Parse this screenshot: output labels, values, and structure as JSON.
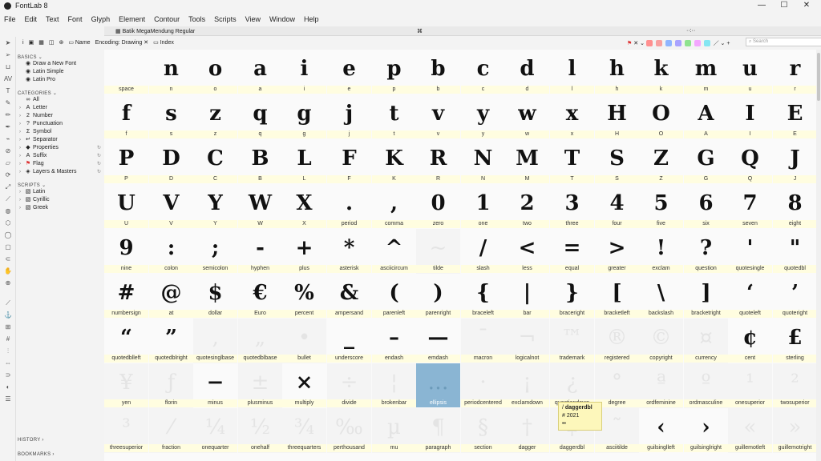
{
  "app": {
    "title": "FontLab 8"
  },
  "menu": [
    "File",
    "Edit",
    "Text",
    "Font",
    "Glyph",
    "Element",
    "Contour",
    "Tools",
    "Scripts",
    "View",
    "Window",
    "Help"
  ],
  "window_controls": {
    "minimize": "—",
    "maximize": "☐",
    "close": "✕"
  },
  "doc_tab": {
    "name": "Batik MegaMendung Regular",
    "center_mark": "⌘",
    "right_mark": "··:··"
  },
  "toolbar": {
    "info": "i",
    "name_label": "Name",
    "encoding_label": "Encoding: Drawing",
    "index_label": "Index",
    "search_placeholder": "Search",
    "color_swatches": [
      "#ff8f8f",
      "#f8a0a0",
      "#8fb5ff",
      "#a9a3ff",
      "#8fe38f",
      "#f4a6ff",
      "#86e6f2"
    ]
  },
  "sidebar": {
    "basics_header": "BASICS",
    "basics": [
      "Draw a New Font",
      "Latin Simple",
      "Latin Pro"
    ],
    "categories_header": "CATEGORIES",
    "categories": [
      {
        "label": "All",
        "icon": "∞"
      },
      {
        "label": "Letter",
        "icon": "A"
      },
      {
        "label": "Number",
        "icon": "2"
      },
      {
        "label": "Punctuation",
        "icon": "?"
      },
      {
        "label": "Symbol",
        "icon": "Σ"
      },
      {
        "label": "Separator",
        "icon": "↵"
      },
      {
        "label": "Properties",
        "icon": "◆"
      },
      {
        "label": "Suffix",
        "icon": "A"
      },
      {
        "label": "Flag",
        "icon": "⚑"
      },
      {
        "label": "Layers & Masters",
        "icon": "◈"
      }
    ],
    "scripts_header": "SCRIPTS",
    "scripts": [
      "Latin",
      "Cyrillic",
      "Greek"
    ],
    "history_header": "HISTORY",
    "bookmarks_header": "BOOKMARKS"
  },
  "glyph_rows": [
    [
      [
        "",
        "space"
      ],
      [
        "n",
        "n"
      ],
      [
        "o",
        "o"
      ],
      [
        "a",
        "a"
      ],
      [
        "i",
        "i"
      ],
      [
        "e",
        "e"
      ],
      [
        "p",
        "p"
      ],
      [
        "b",
        "b"
      ],
      [
        "c",
        "c"
      ],
      [
        "d",
        "d"
      ],
      [
        "l",
        "l"
      ],
      [
        "h",
        "h"
      ],
      [
        "k",
        "k"
      ],
      [
        "m",
        "m"
      ],
      [
        "u",
        "u"
      ],
      [
        "r",
        "r"
      ]
    ],
    [
      [
        "f",
        "f"
      ],
      [
        "s",
        "s"
      ],
      [
        "z",
        "z"
      ],
      [
        "q",
        "q"
      ],
      [
        "g",
        "g"
      ],
      [
        "j",
        "j"
      ],
      [
        "t",
        "t"
      ],
      [
        "v",
        "v"
      ],
      [
        "y",
        "y"
      ],
      [
        "w",
        "w"
      ],
      [
        "x",
        "x"
      ],
      [
        "H",
        "H"
      ],
      [
        "O",
        "O"
      ],
      [
        "A",
        "A"
      ],
      [
        "I",
        "I"
      ],
      [
        "E",
        "E"
      ]
    ],
    [
      [
        "P",
        "P"
      ],
      [
        "D",
        "D"
      ],
      [
        "C",
        "C"
      ],
      [
        "B",
        "B"
      ],
      [
        "L",
        "L"
      ],
      [
        "F",
        "F"
      ],
      [
        "K",
        "K"
      ],
      [
        "R",
        "R"
      ],
      [
        "N",
        "N"
      ],
      [
        "M",
        "M"
      ],
      [
        "T",
        "T"
      ],
      [
        "S",
        "S"
      ],
      [
        "Z",
        "Z"
      ],
      [
        "G",
        "G"
      ],
      [
        "Q",
        "Q"
      ],
      [
        "J",
        "J"
      ]
    ],
    [
      [
        "U",
        "U"
      ],
      [
        "V",
        "V"
      ],
      [
        "Y",
        "Y"
      ],
      [
        "W",
        "W"
      ],
      [
        "X",
        "X"
      ],
      [
        ".",
        "period"
      ],
      [
        ",",
        "comma"
      ],
      [
        "0",
        "zero"
      ],
      [
        "1",
        "one"
      ],
      [
        "2",
        "two"
      ],
      [
        "3",
        "three"
      ],
      [
        "4",
        "four"
      ],
      [
        "5",
        "five"
      ],
      [
        "6",
        "six"
      ],
      [
        "7",
        "seven"
      ],
      [
        "8",
        "eight"
      ]
    ],
    [
      [
        "9",
        "nine"
      ],
      [
        ":",
        "colon"
      ],
      [
        ";",
        "semicolon"
      ],
      [
        "-",
        "hyphen"
      ],
      [
        "+",
        "plus"
      ],
      [
        "*",
        "asterisk"
      ],
      [
        "^",
        "asciicircum"
      ],
      [
        "~",
        "tilde"
      ],
      [
        "/",
        "slash"
      ],
      [
        "<",
        "less"
      ],
      [
        "=",
        "equal"
      ],
      [
        ">",
        "greater"
      ],
      [
        "!",
        "exclam"
      ],
      [
        "?",
        "question"
      ],
      [
        "'",
        "quotesingle"
      ],
      [
        "\"",
        "quotedbl"
      ]
    ],
    [
      [
        "#",
        "numbersign"
      ],
      [
        "@",
        "at"
      ],
      [
        "$",
        "dollar"
      ],
      [
        "€",
        "Euro"
      ],
      [
        "%",
        "percent"
      ],
      [
        "&",
        "ampersand"
      ],
      [
        "(",
        "parenleft"
      ],
      [
        ")",
        "parenright"
      ],
      [
        "{",
        "braceleft"
      ],
      [
        "|",
        "bar"
      ],
      [
        "}",
        "braceright"
      ],
      [
        "[",
        "bracketleft"
      ],
      [
        "\\",
        "backslash"
      ],
      [
        "]",
        "bracketright"
      ],
      [
        "‘",
        "quoteleft"
      ],
      [
        "’",
        "quoteright"
      ]
    ],
    [
      [
        "“",
        "quotedblleft"
      ],
      [
        "”",
        "quotedblright"
      ],
      [
        "‚",
        "quotesinglbase"
      ],
      [
        "„",
        "quotedblbase"
      ],
      [
        "•",
        "bullet"
      ],
      [
        "_",
        "underscore"
      ],
      [
        "–",
        "endash"
      ],
      [
        "—",
        "emdash"
      ],
      [
        "¯",
        "macron"
      ],
      [
        "¬",
        "logicalnot"
      ],
      [
        "™",
        "trademark"
      ],
      [
        "®",
        "registered"
      ],
      [
        "©",
        "copyright"
      ],
      [
        "¤",
        "currency"
      ],
      [
        "¢",
        "cent"
      ],
      [
        "£",
        "sterling"
      ]
    ],
    [
      [
        "¥",
        "yen"
      ],
      [
        "ƒ",
        "florin"
      ],
      [
        "−",
        "minus"
      ],
      [
        "±",
        "plusminus"
      ],
      [
        "×",
        "multiply"
      ],
      [
        "÷",
        "divide"
      ],
      [
        "¦",
        "brokenbar"
      ],
      [
        "…",
        "ellipsis"
      ],
      [
        "·",
        "periodcentered"
      ],
      [
        "¡",
        "exclamdown"
      ],
      [
        "¿",
        "questiondown"
      ],
      [
        "°",
        "degree"
      ],
      [
        "ª",
        "ordfeminine"
      ],
      [
        "º",
        "ordmasculine"
      ],
      [
        "¹",
        "onesuperior"
      ],
      [
        "²",
        "twosuperior"
      ]
    ],
    [
      [
        "³",
        "threesuperior"
      ],
      [
        "⁄",
        "fraction"
      ],
      [
        "¼",
        "onequarter"
      ],
      [
        "½",
        "onehalf"
      ],
      [
        "¾",
        "threequarters"
      ],
      [
        "‰",
        "perthousand"
      ],
      [
        "µ",
        "mu"
      ],
      [
        "¶",
        "paragraph"
      ],
      [
        "§",
        "section"
      ],
      [
        "†",
        "dagger"
      ],
      [
        "‡",
        "daggerdbl"
      ],
      [
        "˜",
        "asciitilde"
      ],
      [
        "‹",
        "guilsinglleft"
      ],
      [
        "›",
        "guilsinglright"
      ],
      [
        "«",
        "guillemotleft"
      ],
      [
        "»",
        "guillemotright"
      ]
    ]
  ],
  "empty_cells": [
    "tilde",
    "quotesinglbase",
    "quotedblbase",
    "bullet",
    "macron",
    "logicalnot",
    "trademark",
    "registered",
    "copyright",
    "currency",
    "yen",
    "florin",
    "plusminus",
    "divide",
    "brokenbar",
    "periodcentered",
    "exclamdown",
    "questiondown",
    "degree",
    "ordfeminine",
    "ordmasculine",
    "onesuperior",
    "twosuperior",
    "threesuperior",
    "fraction",
    "onequarter",
    "onehalf",
    "threequarters",
    "perthousand",
    "mu",
    "paragraph",
    "section",
    "dagger",
    "daggerdbl",
    "asciitilde",
    "guillemotleft",
    "guillemotright"
  ],
  "selected_cell": "ellipsis",
  "tooltip": {
    "name": "daggerdbl",
    "code": "2021",
    "extra": "••"
  }
}
